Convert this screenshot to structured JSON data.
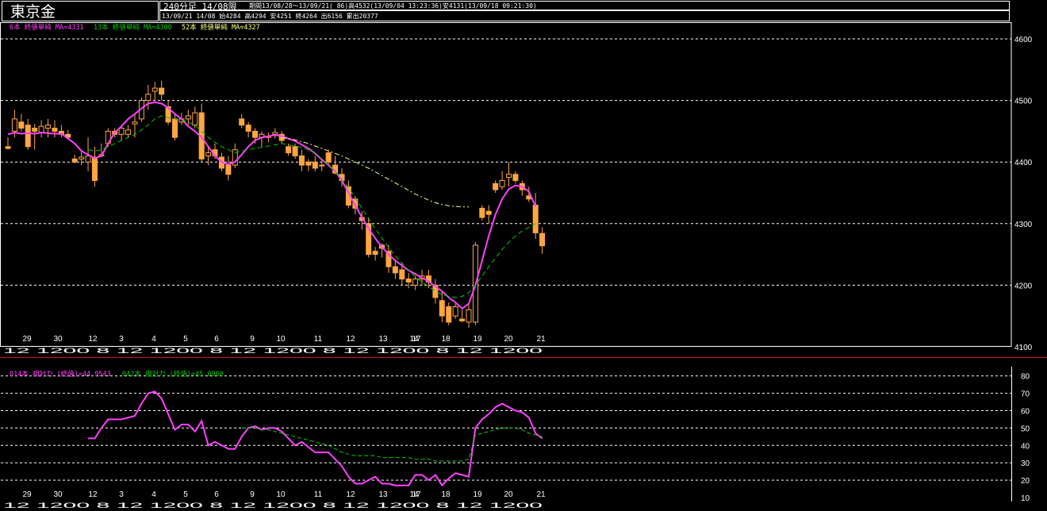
{
  "header": {
    "title": "東京金",
    "period_label": "240分足 14/08限",
    "period_range": "期間13/08/28～13/09/21( 86)高4532(13/09/04 13:23:36)安4131(13/09/18 09:21:30)",
    "info": "13/09/21 14/08 始4284 高4294 安4251 終4264 出6156 累出20377"
  },
  "legend_top": {
    "ma6": "6本 終値単純 MA=4331",
    "ma13": "13本 終値単純 MA=4300",
    "ma52": "52本 終値単純 MA=4327"
  },
  "legend_bottom": {
    "rsi14": "014本 相対力 (終値)=44.9543",
    "rsi42": "042本 相対力 (終値)=45.0960"
  },
  "date_labels": [
    "29",
    "30",
    "3",
    "4",
    "5",
    "6",
    "9",
    "10",
    "11",
    "12",
    "13",
    "17",
    "18",
    "19",
    "20",
    "21"
  ],
  "date_label_extra": [
    "12",
    "14"
  ],
  "time_labels_text": "12 1200 8 12 1200 8 12 1200 8 12 1200 8 12 1200",
  "colors": {
    "up_candle": "#ffa640",
    "down_candle": "#ffa640",
    "ma6": "#ff40ff",
    "ma13": "#00cc00",
    "ma52": "#ffff80",
    "rsi14": "#ff40ff",
    "rsi42": "#00cc00",
    "grid": "#ffffff",
    "separator": "#d01010"
  },
  "chart_data": [
    {
      "type": "candlestick",
      "title": "",
      "ylim": [
        4100,
        4620
      ],
      "y_ticks": [
        4100,
        4200,
        4300,
        4400,
        4500,
        4600
      ],
      "x_day_labels": [
        "29",
        "30",
        "3",
        "4",
        "5",
        "6",
        "9",
        "10",
        "11",
        "12",
        "13",
        "17",
        "18",
        "19",
        "20",
        "21"
      ],
      "candles": [
        [
          4425,
          4440,
          4420,
          4422
        ],
        [
          4450,
          4485,
          4440,
          4470
        ],
        [
          4465,
          4478,
          4450,
          4455
        ],
        [
          4460,
          4470,
          4420,
          4425
        ],
        [
          4455,
          4462,
          4420,
          4450
        ],
        [
          4448,
          4468,
          4440,
          4458
        ],
        [
          4455,
          4470,
          4440,
          4460
        ],
        [
          4455,
          4468,
          4440,
          4450
        ],
        [
          4450,
          4460,
          4440,
          4445
        ],
        [
          4445,
          4452,
          4438,
          4440
        ],
        [
          4405,
          4412,
          4398,
          4400
        ],
        [
          4405,
          4418,
          4395,
          4408
        ],
        [
          4400,
          4440,
          4385,
          4410
        ],
        [
          4408,
          4425,
          4360,
          4370
        ],
        [
          4410,
          4430,
          4408,
          4412
        ],
        [
          4430,
          4455,
          4425,
          4450
        ],
        [
          4450,
          4455,
          4440,
          4445
        ],
        [
          4445,
          4460,
          4435,
          4455
        ],
        [
          4445,
          4460,
          4440,
          4452
        ],
        [
          4462,
          4480,
          4440,
          4465
        ],
        [
          4470,
          4505,
          4465,
          4500
        ],
        [
          4500,
          4525,
          4485,
          4510
        ],
        [
          4515,
          4530,
          4500,
          4520
        ],
        [
          4520,
          4532,
          4500,
          4510
        ],
        [
          4490,
          4500,
          4460,
          4465
        ],
        [
          4470,
          4480,
          4435,
          4440
        ],
        [
          4465,
          4480,
          4460,
          4470
        ],
        [
          4470,
          4485,
          4460,
          4475
        ],
        [
          4460,
          4490,
          4455,
          4480
        ],
        [
          4480,
          4495,
          4400,
          4405
        ],
        [
          4410,
          4425,
          4395,
          4415
        ],
        [
          4420,
          4430,
          4405,
          4410
        ],
        [
          4408,
          4415,
          4385,
          4390
        ],
        [
          4395,
          4410,
          4370,
          4380
        ],
        [
          4395,
          4430,
          4390,
          4420
        ],
        [
          4470,
          4478,
          4455,
          4460
        ],
        [
          4460,
          4465,
          4440,
          4450
        ],
        [
          4450,
          4455,
          4430,
          4440
        ],
        [
          4440,
          4450,
          4425,
          4445
        ],
        [
          4440,
          4448,
          4432,
          4442
        ],
        [
          4445,
          4455,
          4438,
          4448
        ],
        [
          4445,
          4450,
          4430,
          4435
        ],
        [
          4425,
          4430,
          4410,
          4415
        ],
        [
          4425,
          4430,
          4405,
          4410
        ],
        [
          4410,
          4420,
          4385,
          4395
        ],
        [
          4400,
          4405,
          4385,
          4395
        ],
        [
          4400,
          4410,
          4385,
          4390
        ],
        [
          4395,
          4405,
          4385,
          4395
        ],
        [
          4415,
          4420,
          4395,
          4400
        ],
        [
          4395,
          4410,
          4380,
          4382
        ],
        [
          4380,
          4390,
          4360,
          4370
        ],
        [
          4360,
          4370,
          4325,
          4330
        ],
        [
          4340,
          4345,
          4315,
          4325
        ],
        [
          4310,
          4320,
          4290,
          4305
        ],
        [
          4300,
          4310,
          4245,
          4250
        ],
        [
          4255,
          4262,
          4240,
          4250
        ],
        [
          4265,
          4268,
          4245,
          4260
        ],
        [
          4255,
          4265,
          4220,
          4230
        ],
        [
          4230,
          4240,
          4210,
          4220
        ],
        [
          4225,
          4235,
          4200,
          4210
        ],
        [
          4210,
          4220,
          4195,
          4205
        ],
        [
          4200,
          4215,
          4192,
          4210
        ],
        [
          4210,
          4225,
          4200,
          4215
        ],
        [
          4215,
          4225,
          4195,
          4205
        ],
        [
          4200,
          4210,
          4170,
          4180
        ],
        [
          4175,
          4190,
          4140,
          4150
        ],
        [
          4165,
          4172,
          4135,
          4140
        ],
        [
          4150,
          4170,
          4145,
          4165
        ],
        [
          4145,
          4160,
          4140,
          4142
        ],
        [
          4140,
          4170,
          4131,
          4160
        ],
        [
          4140,
          4270,
          4135,
          4265
        ],
        [
          4325,
          4330,
          4305,
          4310
        ],
        [
          4320,
          4330,
          4300,
          4315
        ],
        [
          4365,
          4370,
          4350,
          4355
        ],
        [
          4360,
          4385,
          4355,
          4370
        ],
        [
          4375,
          4400,
          4360,
          4380
        ],
        [
          4380,
          4385,
          4365,
          4370
        ],
        [
          4365,
          4370,
          4345,
          4355
        ],
        [
          4345,
          4360,
          4335,
          4340
        ],
        [
          4330,
          4350,
          4275,
          4285
        ],
        [
          4284,
          4294,
          4251,
          4264
        ]
      ],
      "series": [
        {
          "name": "6本 終値単純",
          "values": [
            4445,
            4448,
            4446,
            4447,
            4446,
            4448,
            4447,
            4446,
            4446,
            4438,
            4430,
            4418,
            4412,
            4406,
            4410,
            4430,
            4448,
            4458,
            4470,
            4478,
            4487,
            4495,
            4497,
            4495,
            4488,
            4478,
            4470,
            4458,
            4450,
            4440,
            4425,
            4410,
            4400,
            4396,
            4400,
            4412,
            4425,
            4435,
            4440,
            4442,
            4444,
            4442,
            4438,
            4434,
            4428,
            4422,
            4414,
            4404,
            4395,
            4385,
            4370,
            4350,
            4330,
            4310,
            4292,
            4276,
            4262,
            4250,
            4240,
            4232,
            4224,
            4218,
            4212,
            4206,
            4198,
            4190,
            4180,
            4172,
            4162,
            4170,
            4200,
            4240,
            4280,
            4315,
            4340,
            4356,
            4362,
            4360,
            4352,
            4328
          ]
        },
        {
          "name": "13本 終値単純",
          "values": [
            null,
            null,
            null,
            null,
            null,
            null,
            null,
            null,
            null,
            null,
            null,
            null,
            4420,
            4418,
            4420,
            4425,
            4430,
            4435,
            4440,
            4445,
            4452,
            4460,
            4470,
            4475,
            4472,
            4470,
            4468,
            4465,
            4460,
            4450,
            4440,
            4432,
            4425,
            4420,
            4415,
            4418,
            4420,
            4422,
            4424,
            4426,
            4428,
            4430,
            4428,
            4426,
            4424,
            4420,
            4415,
            4405,
            4395,
            4385,
            4372,
            4358,
            4342,
            4325,
            4308,
            4292,
            4276,
            4262,
            4248,
            4236,
            4224,
            4214,
            4205,
            4198,
            4190,
            4185,
            4182,
            4180,
            4182,
            4188,
            4200,
            4215,
            4230,
            4244,
            4258,
            4270,
            4280,
            4288,
            4294,
            4300
          ]
        },
        {
          "name": "52本 終値単純",
          "values": [
            null,
            null,
            null,
            null,
            null,
            null,
            null,
            null,
            null,
            null,
            null,
            null,
            null,
            null,
            null,
            null,
            null,
            null,
            null,
            null,
            null,
            null,
            null,
            null,
            null,
            null,
            null,
            null,
            null,
            null,
            null,
            null,
            null,
            null,
            null,
            null,
            null,
            null,
            null,
            null,
            null,
            4440,
            4438,
            4436,
            4433,
            4430,
            4426,
            4422,
            4418,
            4414,
            4410,
            4405,
            4400,
            4395,
            4390,
            4384,
            4378,
            4372,
            4366,
            4360,
            4354,
            4348,
            4343,
            4338,
            4334,
            4331,
            4329,
            4328,
            4327,
            4327
          ]
        }
      ]
    },
    {
      "type": "line",
      "title": "",
      "ylim": [
        10,
        80
      ],
      "y_ticks": [
        10,
        20,
        30,
        40,
        50,
        60,
        70,
        80
      ],
      "x_day_labels": [
        "29",
        "30",
        "3",
        "4",
        "5",
        "6",
        "9",
        "10",
        "11",
        "12",
        "13",
        "17",
        "18",
        "19",
        "20",
        "21"
      ],
      "series": [
        {
          "name": "014本 相対力 (終値)",
          "values": [
            null,
            null,
            null,
            null,
            null,
            null,
            null,
            null,
            null,
            null,
            null,
            null,
            44,
            44,
            50,
            55,
            55,
            55,
            56,
            57,
            64,
            70,
            71,
            67,
            58,
            49,
            52,
            52,
            48,
            54,
            40,
            42,
            40,
            38,
            38,
            45,
            50,
            51,
            49,
            50,
            50,
            48,
            44,
            40,
            42,
            39,
            36,
            36,
            36,
            32,
            28,
            22,
            18,
            18,
            20,
            22,
            18,
            18,
            17,
            17,
            17,
            23,
            23,
            20,
            23,
            17,
            21,
            24,
            23,
            22,
            50,
            55,
            58,
            62,
            64,
            62,
            60,
            59,
            56,
            47,
            44
          ]
        },
        {
          "name": "042本 相対力 (終値)",
          "values": [
            null,
            null,
            null,
            null,
            null,
            null,
            null,
            null,
            null,
            null,
            null,
            null,
            null,
            null,
            null,
            null,
            null,
            null,
            null,
            null,
            null,
            null,
            null,
            null,
            null,
            null,
            null,
            null,
            null,
            null,
            null,
            null,
            null,
            null,
            null,
            50,
            50,
            50,
            49,
            49,
            48,
            47,
            46,
            45,
            44,
            43,
            42,
            41,
            40,
            38,
            36,
            35,
            34,
            34,
            34,
            34,
            33,
            33,
            33,
            33,
            33,
            32,
            32,
            32,
            31,
            31,
            31,
            31,
            31,
            32,
            46,
            47,
            48,
            49,
            50,
            50,
            50,
            49,
            47,
            46,
            45
          ]
        }
      ]
    }
  ]
}
